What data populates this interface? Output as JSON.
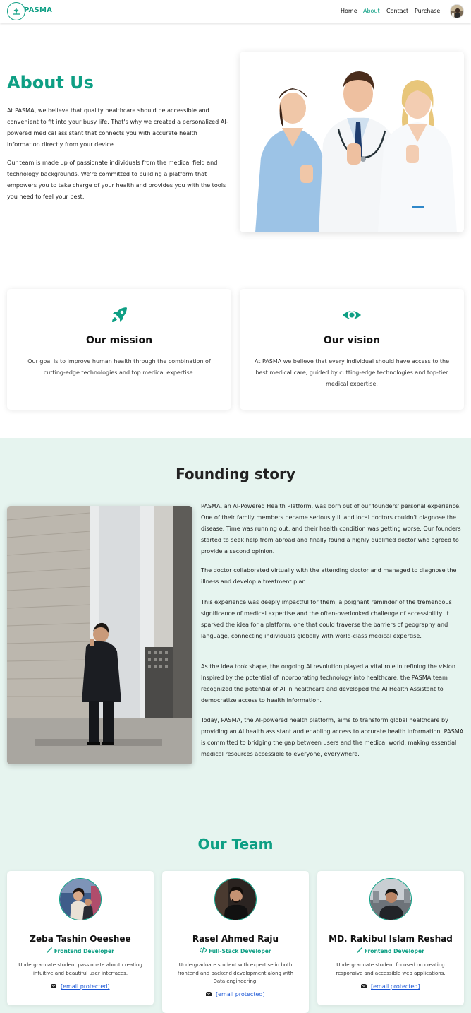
{
  "header": {
    "logo_text": "PASMA",
    "nav": [
      "Home",
      "About",
      "Contact",
      "Purchase"
    ],
    "active": "About"
  },
  "about": {
    "title": "About Us",
    "paragraphs": [
      "At PASMA, we believe that quality healthcare should be accessible and convenient to fit into your busy life. That's why we created a personalized AI-powered medical assistant that connects you with accurate health information directly from your device.",
      "Our team is made up of passionate individuals from the medical field and technology backgrounds. We're committed to building a platform that empowers you to take charge of your health and provides you with the tools you need to feel your best."
    ]
  },
  "mission": {
    "title": "Our mission",
    "text": "Our goal is to improve human health through the combination of cutting-edge technologies and top medical expertise.",
    "icon": "rocket-icon"
  },
  "vision": {
    "title": "Our vision",
    "text": "At PASMA we believe that every individual should have access to the best medical care, guided by cutting-edge technologies and top-tier medical expertise.",
    "icon": "eye-icon"
  },
  "founding": {
    "title": "Founding story",
    "paragraphs": [
      "PASMA, an AI-Powered Health Platform, was born out of our founders' personal experience. One of their family members became seriously ill and local doctors couldn't diagnose the disease. Time was running out, and their health condition was getting worse. Our founders started to seek help from abroad and finally found a highly qualified doctor who agreed to provide a second opinion.",
      "The doctor collaborated virtually with the attending doctor and managed to diagnose the illness and develop a treatment plan.",
      "This experience was deeply impactful for them, a poignant reminder of the tremendous significance of medical expertise and the often-overlooked challenge of accessibility. It sparked the idea for a platform, one that could traverse the barriers of geography and language, connecting individuals globally with world-class medical expertise.",
      "As the idea took shape, the ongoing AI revolution played a vital role in refining the vision. Inspired by the potential of incorporating technology into healthcare, the PASMA team recognized the potential of AI in healthcare and developed the AI Health Assistant to democratize access to health information.",
      "Today, PASMA, the AI-powered health platform, aims to transform global healthcare by providing an AI health assistant and enabling access to accurate health information. PASMA is committed to bridging the gap between users and the medical world, making essential medical resources accessible to everyone, everywhere."
    ]
  },
  "team": {
    "title": "Our Team",
    "members": [
      {
        "name": "Zeba Tashin Oeeshee",
        "role": "Frontend Developer",
        "role_icon": "brush-icon",
        "desc": "Undergraduate student passionate about creating intuitive and beautiful user interfaces.",
        "email": "[email protected]"
      },
      {
        "name": "Rasel Ahmed Raju",
        "role": "Full-Stack Developer",
        "role_icon": "code-icon",
        "desc": "Undergraduate student with expertise in both frontend and backend development along with Data engineering.",
        "email": "[email protected]"
      },
      {
        "name": "MD. Rakibul Islam Reshad",
        "role": "Frontend Developer",
        "role_icon": "brush-icon",
        "desc": "Undergraduate student focused on creating responsive and accessible web applications.",
        "email": "[email protected]"
      }
    ]
  },
  "colors": {
    "accent": "#0e9f84",
    "founding_bg": "#e6f4ef",
    "link": "#1a56d6"
  }
}
